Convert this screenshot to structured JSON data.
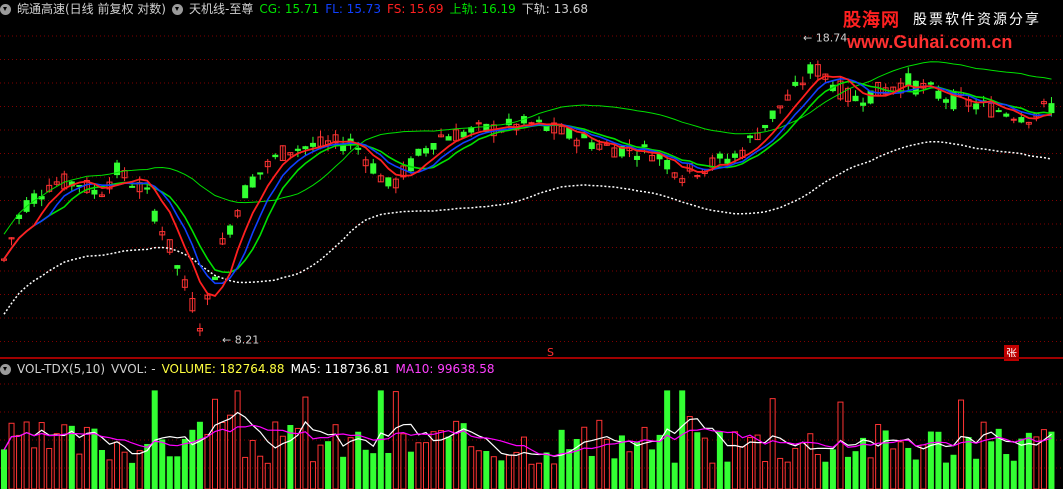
{
  "header": {
    "title": "皖通高速(日线 前复权 对数)",
    "indicator": "天机线-至尊",
    "cg": "CG: 15.71",
    "fl": "FL: 15.73",
    "fs": "FS: 15.69",
    "upper": "上轨: 16.19",
    "lower": "下轨: 13.68"
  },
  "vol_header": {
    "name": "VOL-TDX(5,10)",
    "vvol": "VVOL: -",
    "volume": "VOLUME: 182764.88",
    "ma5": "MA5: 118736.81",
    "ma10": "MA10: 99638.58"
  },
  "annotations": {
    "high": "18.74",
    "low": "8.21",
    "s_mark": "S",
    "zhang_mark": "张"
  },
  "watermark": {
    "name": "股海网",
    "slogan": "股票软件资源分享",
    "url": "www.Guhai.com.cn"
  },
  "colors": {
    "up": "#ff3333",
    "down": "#33ff33",
    "cg": "#00e000",
    "fl": "#1040ff",
    "fs": "#ff2020",
    "upper": "#00e000",
    "lower": "#ffffff",
    "ma5": "#ffffff",
    "ma10": "#ff00ff",
    "volume_label": "#ffff40",
    "bg": "#000000",
    "grid": "#800000"
  },
  "chart_data": [
    {
      "type": "candlestick",
      "scale": "log",
      "ylim": [
        8.0,
        19.5
      ],
      "series": [
        {
          "name": "CG",
          "values": [
            15.71
          ]
        },
        {
          "name": "FL",
          "values": [
            15.73
          ]
        },
        {
          "name": "FS",
          "values": [
            15.69
          ]
        },
        {
          "name": "上轨",
          "values": [
            16.19
          ]
        },
        {
          "name": "下轨",
          "values": [
            13.68
          ]
        }
      ],
      "marked_high": 18.74,
      "marked_low": 8.21,
      "grid": true
    },
    {
      "type": "bar",
      "series": [
        {
          "name": "VOLUME",
          "values": [
            182764.88
          ]
        },
        {
          "name": "MA5",
          "values": [
            118736.81
          ]
        },
        {
          "name": "MA10",
          "values": [
            99638.58
          ]
        }
      ],
      "grid": true
    }
  ]
}
